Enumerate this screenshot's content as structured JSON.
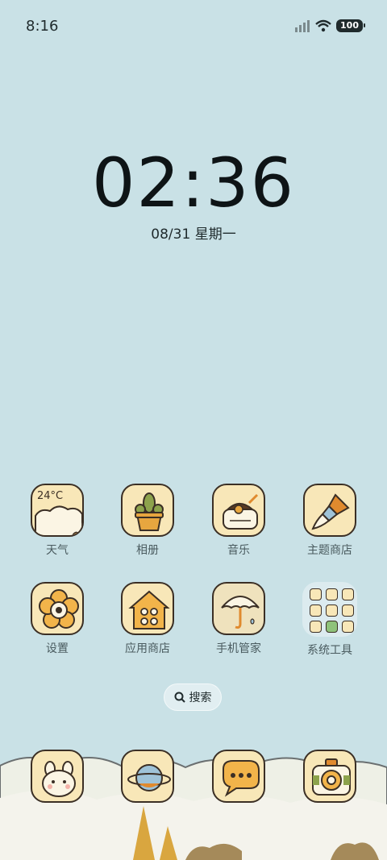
{
  "status_bar": {
    "time": "8:16",
    "battery": "100"
  },
  "lock_clock": {
    "time": "02:36",
    "date": "08/31 星期一"
  },
  "weather_widget": {
    "temperature": "24°C"
  },
  "apps_row1": [
    {
      "label": "天气",
      "icon": "weather-icon"
    },
    {
      "label": "相册",
      "icon": "plant-pot-icon"
    },
    {
      "label": "音乐",
      "icon": "music-chick-icon"
    },
    {
      "label": "主题商店",
      "icon": "paintbrush-icon"
    }
  ],
  "apps_row2": [
    {
      "label": "设置",
      "icon": "flower-gear-icon"
    },
    {
      "label": "应用商店",
      "icon": "house-icon"
    },
    {
      "label": "手机管家",
      "icon": "umbrella-icon"
    },
    {
      "label": "系统工具",
      "icon": "folder-icon"
    }
  ],
  "search": {
    "label": "搜索"
  },
  "dock": [
    {
      "icon": "bunny-icon"
    },
    {
      "icon": "planet-icon"
    },
    {
      "icon": "chat-bubble-icon"
    },
    {
      "icon": "camera-icon"
    }
  ],
  "colors": {
    "background": "#c9e1e6",
    "icon_bg": "#f8e7b8",
    "outline": "#3b2f25"
  }
}
